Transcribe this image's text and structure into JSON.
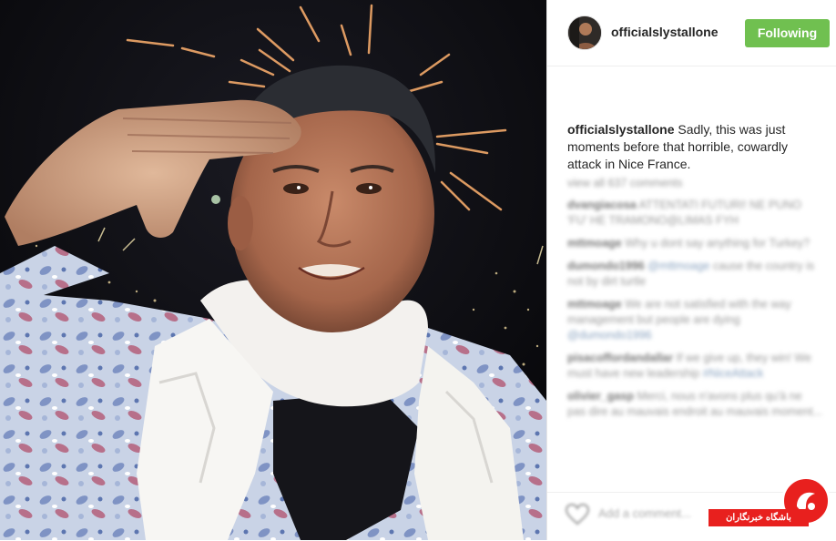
{
  "post": {
    "username": "officialslystallone",
    "follow_label": "Following",
    "caption_user": "officialslystallone",
    "caption_text": " Sadly, this was just moments before that horrible, cowardly attack in Nice France.",
    "view_all": "view all 637 comments",
    "comments": [
      {
        "user": "dvangiacosa",
        "text": "ATTENTATI FUTURI! NE PUNO 'FU' HE TRAMONO@LIMAS FYH"
      },
      {
        "user": "mttmoage",
        "text": "Why u dont say anything for Turkey?",
        "link": ""
      },
      {
        "user": "dumondo1996",
        "text": "cause the country is not by dirt turtle",
        "link": "@mttmoage"
      },
      {
        "user": "mttmoage",
        "text": "We are not satisfied with the way management but people are dying",
        "link": "@dumondo1996"
      },
      {
        "user": "pisacoffordandallar",
        "text": "If we give up, they win! We must have new leadership",
        "link": "#NiceAttack"
      },
      {
        "user": "olivier_gasp",
        "text": "Merci, nous n'avons plus qu'à ne pas dire au mauvais endroit au mauvais moment..."
      }
    ],
    "add_comment_placeholder": "Add a comment..."
  },
  "watermark": {
    "label": "باشگاه خبرنگاران",
    "color": "#e8201e"
  },
  "colors": {
    "follow_button": "#70c050",
    "text": "#262626"
  }
}
